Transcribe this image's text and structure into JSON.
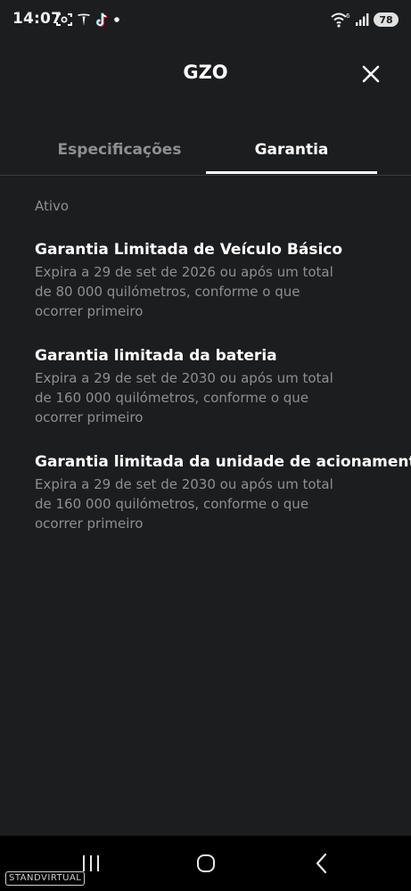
{
  "status_bar": {
    "time": "14:07",
    "battery": "78",
    "wifi_badge": "6"
  },
  "header": {
    "title": "GZO"
  },
  "tabs": [
    {
      "label": "Especificações",
      "active": false
    },
    {
      "label": "Garantia",
      "active": true
    }
  ],
  "section": {
    "label": "Ativo"
  },
  "warranties": [
    {
      "title": "Garantia Limitada de Veículo Básico",
      "description": "Expira a 29 de set de 2026 ou após um total de 80 000 quilómetros, conforme o que ocorrer primeiro"
    },
    {
      "title": "Garantia limitada da bateria",
      "description": "Expira a 29 de set de 2030 ou após um total de 160 000 quilómetros, conforme o que ocorrer primeiro"
    },
    {
      "title": "Garantia limitada da unidade de acionamento",
      "description": "Expira a 29 de set de 2030 ou após um total de 160 000 quilómetros, conforme o que ocorrer primeiro"
    }
  ],
  "watermark": {
    "text": "STANDVIRTUAL"
  },
  "icons": {
    "close": "close-icon",
    "recent_apps": "recent-apps-icon",
    "home": "home-icon",
    "back": "back-icon"
  },
  "colors": {
    "background": "#1c1d1f",
    "text_primary": "#ffffff",
    "text_secondary": "#8e8f92",
    "divider": "#3a3b3d",
    "nav_bar": "#000000"
  }
}
